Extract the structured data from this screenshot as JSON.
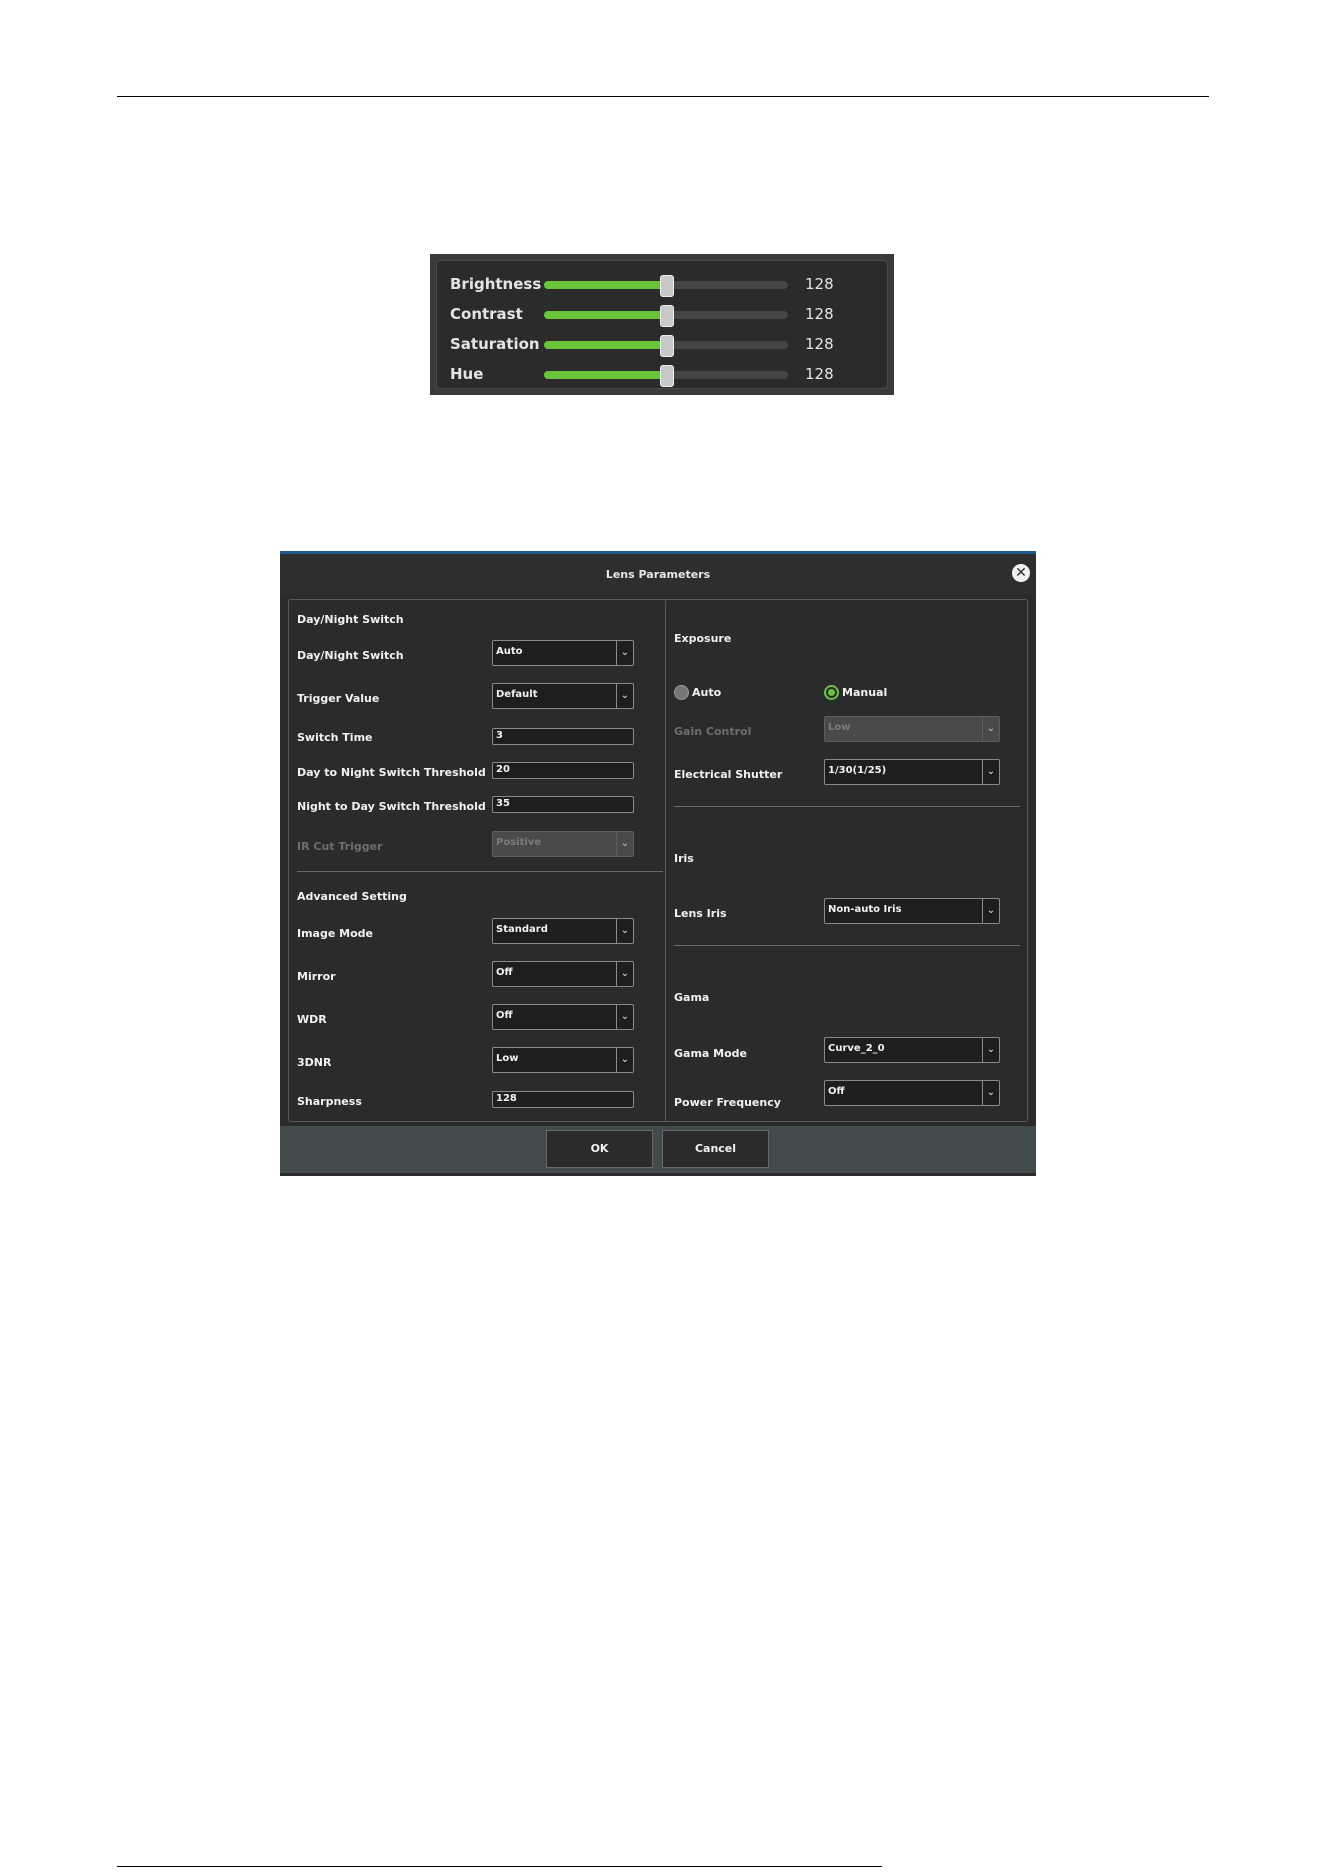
{
  "color_adjust": {
    "sliders": [
      {
        "label": "Brightness",
        "value": "128",
        "fraction": 0.5
      },
      {
        "label": "Contrast",
        "value": "128",
        "fraction": 0.5
      },
      {
        "label": "Saturation",
        "value": "128",
        "fraction": 0.5
      },
      {
        "label": "Hue",
        "value": "128",
        "fraction": 0.5
      }
    ],
    "accent_color": "#69c43a"
  },
  "dialog": {
    "title": "Lens Parameters",
    "close_icon": "close-icon",
    "left": {
      "day_night_section": "Day/Night Switch",
      "day_night_switch": {
        "label": "Day/Night Switch",
        "value": "Auto"
      },
      "trigger_value": {
        "label": "Trigger Value",
        "value": "Default"
      },
      "switch_time": {
        "label": "Switch Time",
        "value": "3"
      },
      "day_to_night": {
        "label": "Day to Night Switch Threshold",
        "value": "20"
      },
      "night_to_day": {
        "label": "Night to Day Switch Threshold",
        "value": "35"
      },
      "ir_cut_trigger": {
        "label": "IR Cut Trigger",
        "value": "Positive"
      },
      "advanced_section": "Advanced Setting",
      "image_mode": {
        "label": "Image Mode",
        "value": "Standard"
      },
      "mirror": {
        "label": "Mirror",
        "value": "Off"
      },
      "wdr": {
        "label": "WDR",
        "value": "Off"
      },
      "dnr": {
        "label": "3DNR",
        "value": "Low"
      },
      "sharpness": {
        "label": "Sharpness",
        "value": "128"
      }
    },
    "right": {
      "exposure_section": "Exposure",
      "radio_auto": "Auto",
      "radio_manual": "Manual",
      "exposure_selected": "Manual",
      "gain_control": {
        "label": "Gain Control",
        "value": "Low"
      },
      "electrical_shutter": {
        "label": "Electrical Shutter",
        "value": "1/30(1/25)"
      },
      "iris_section": "Iris",
      "lens_iris": {
        "label": "Lens Iris",
        "value": "Non-auto Iris"
      },
      "gama_section": "Gama",
      "gama_mode": {
        "label": "Gama Mode",
        "value": "Curve_2_0"
      },
      "power_frequency": {
        "label": "Power Frequency",
        "value": "Off"
      }
    },
    "buttons": {
      "ok": "OK",
      "cancel": "Cancel"
    }
  }
}
